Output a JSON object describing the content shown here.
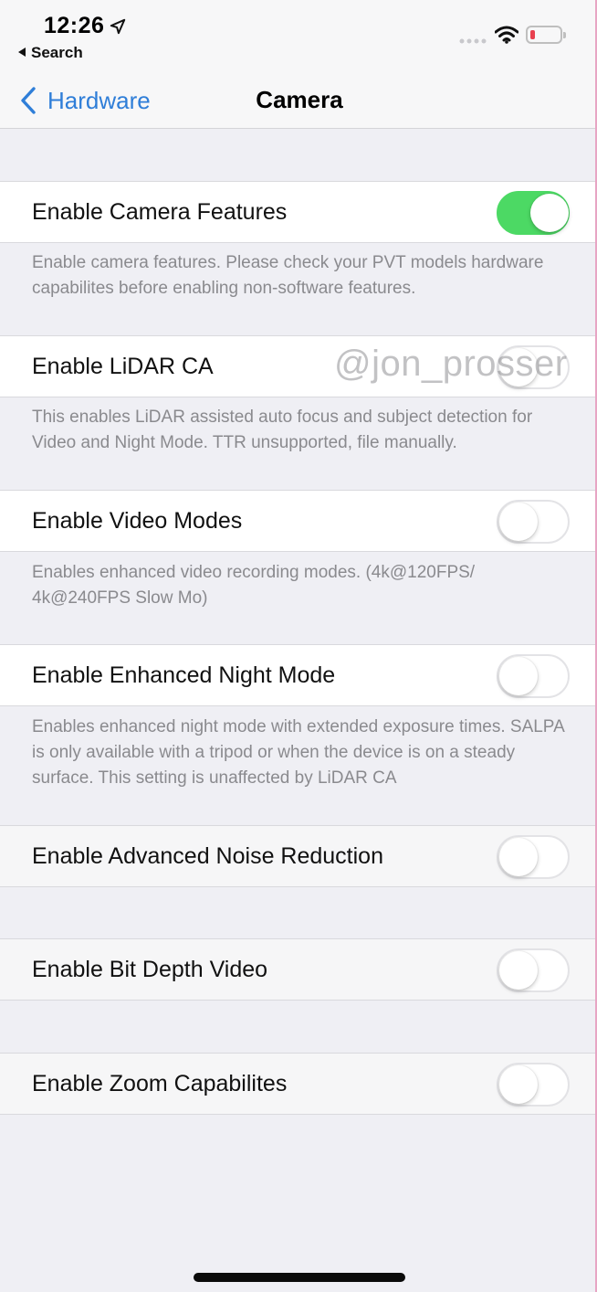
{
  "status_bar": {
    "time": "12:26",
    "back_app": "Search",
    "battery_color": "#e8404f"
  },
  "nav": {
    "back_label": "Hardware",
    "title": "Camera"
  },
  "watermark": "@jon_prosser",
  "settings": [
    {
      "label": "Enable Camera Features",
      "on": true,
      "footer": "Enable camera features. Please check your PVT models hardware capabilites before enabling non-software features."
    },
    {
      "label": "Enable LiDAR CA",
      "on": false,
      "footer": "This enables LiDAR assisted auto focus and subject detection for Video and Night Mode. TTR unsupported, file manually."
    },
    {
      "label": "Enable Video Modes",
      "on": false,
      "footer": "Enables enhanced video recording modes. (4k@120FPS/ 4k@240FPS Slow Mo)"
    },
    {
      "label": "Enable Enhanced Night Mode",
      "on": false,
      "footer": "Enables enhanced night mode with extended exposure times. SALPA is only available with a tripod or when the device is on a steady surface. This setting is unaffected by LiDAR CA"
    },
    {
      "label": "Enable Advanced Noise Reduction",
      "on": false
    },
    {
      "label": "Enable Bit Depth Video",
      "on": false
    },
    {
      "label": "Enable Zoom Capabilites",
      "on": false
    }
  ],
  "colors": {
    "accent_blue": "#2f7ed8",
    "toggle_on": "#4cd964",
    "background": "#efeff4"
  }
}
